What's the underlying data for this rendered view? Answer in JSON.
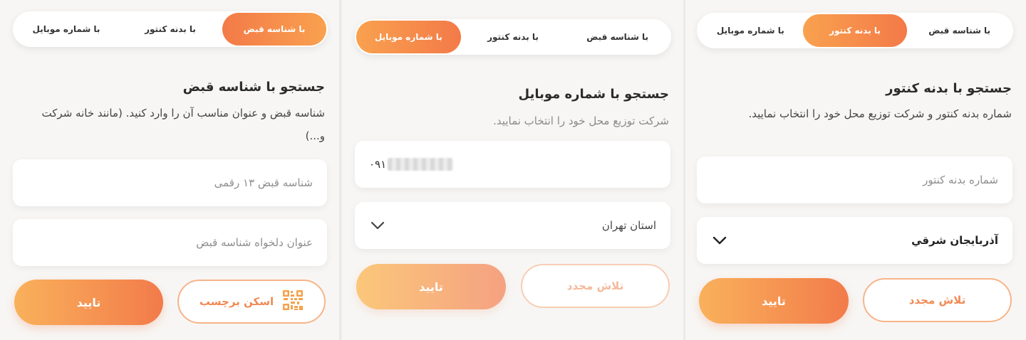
{
  "panels": [
    {
      "tabs": [
        "با شناسه قبض",
        "با بدنه کنتور",
        "با شماره موبایل"
      ],
      "title": "جستجو با شناسه قبض",
      "description": "شناسه قبض و عنوان مناسب آن را وارد کنید. (مانند خانه شرکت و...)",
      "inputs": [
        "شناسه قبض ۱۳ رقمی",
        "عنوان دلخواه شناسه قبض"
      ],
      "confirm_label": "تایید",
      "scan_label": "اسکن برچسب",
      "scan_icon": "qr-code-icon"
    },
    {
      "tabs": [
        "با شماره موبایل",
        "با بدنه کنتور",
        "با شناسه قبض"
      ],
      "title": "جستجو با شماره موبایل",
      "description": "شرکت توزیع محل خود را انتخاب نمایید.",
      "phone_prefix": "۰۹۱",
      "province": "استان تهران",
      "confirm_label": "تایید",
      "retry_label": "تلاش مجدد"
    },
    {
      "tabs": [
        "با شناسه قبض",
        "با بدنه کنتور",
        "با شماره موبایل"
      ],
      "title": "جستجو با بدنه کنتور",
      "description": "شماره بدنه کنتور و شرکت توزیع محل خود را انتخاب نمایید.",
      "meter_placeholder": "شماره بدنه کنتور",
      "province": "آذربایجان شرقي",
      "confirm_label": "تایید",
      "retry_label": "تلاش مجدد"
    }
  ],
  "colors": {
    "accent_start": "#f37a48",
    "accent_end": "#f9a14f",
    "outline": "#f7b48a",
    "background": "#f7f6f4"
  }
}
